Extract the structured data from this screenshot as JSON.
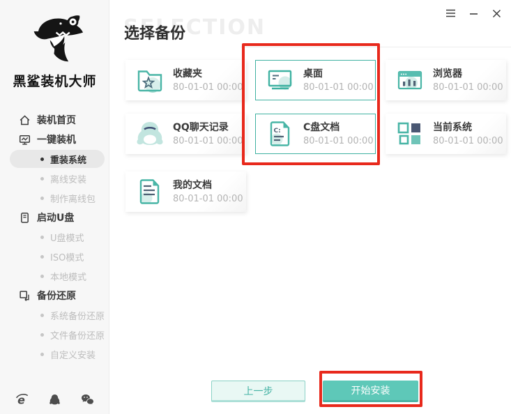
{
  "window": {
    "controls": [
      {
        "icon": "menu-icon"
      },
      {
        "icon": "minimize-icon"
      },
      {
        "icon": "close-icon"
      }
    ]
  },
  "sidebar": {
    "logo_text": "黑鲨装机大师",
    "logo_icon": "shark-logo",
    "items": [
      {
        "label": "装机首页",
        "type": "top",
        "icon": "home-icon"
      },
      {
        "label": "一键装机",
        "type": "top",
        "icon": "monitor-chart-icon"
      },
      {
        "label": "重装系统",
        "type": "sub",
        "active": true
      },
      {
        "label": "离线安装",
        "type": "sub"
      },
      {
        "label": "制作离线包",
        "type": "sub"
      },
      {
        "label": "启动U盘",
        "type": "top",
        "icon": "usb-icon"
      },
      {
        "label": "U盘模式",
        "type": "sub"
      },
      {
        "label": "ISO模式",
        "type": "sub"
      },
      {
        "label": "本地模式",
        "type": "sub"
      },
      {
        "label": "备份还原",
        "type": "top",
        "icon": "restore-icon"
      },
      {
        "label": "系统备份还原",
        "type": "sub"
      },
      {
        "label": "文件备份还原",
        "type": "sub"
      },
      {
        "label": "自定义安装",
        "type": "sub"
      }
    ],
    "footer_icons": [
      "ie-icon",
      "qq-icon",
      "wechat-icon"
    ]
  },
  "main": {
    "title": "选择备份",
    "watermark": "SELECTION",
    "cards": [
      {
        "title": "收藏夹",
        "date": "80-01-01 00:00",
        "selected": false,
        "icon": "favorites-folder-icon"
      },
      {
        "title": "桌面",
        "date": "80-01-01 00:00",
        "selected": true,
        "icon": "desktop-icon"
      },
      {
        "title": "浏览器",
        "date": "80-01-01 00:00",
        "selected": false,
        "icon": "browser-icon"
      },
      {
        "title": "QQ聊天记录",
        "date": "80-01-01 00:00",
        "selected": false,
        "icon": "qq-chat-icon"
      },
      {
        "title": "C盘文档",
        "date": "80-01-01 00:00",
        "selected": true,
        "icon": "c-drive-doc-icon"
      },
      {
        "title": "当前系统",
        "date": "80-01-01 00:00",
        "selected": false,
        "icon": "current-system-icon"
      },
      {
        "title": "我的文档",
        "date": "80-01-01 00:00",
        "selected": false,
        "icon": "my-documents-icon"
      }
    ],
    "buttons": {
      "prev": "上一步",
      "start": "开始安装"
    },
    "colors": {
      "accent": "#5ec8b8",
      "card_border": "#3eb1a1",
      "annotation": "#e8291c"
    }
  }
}
